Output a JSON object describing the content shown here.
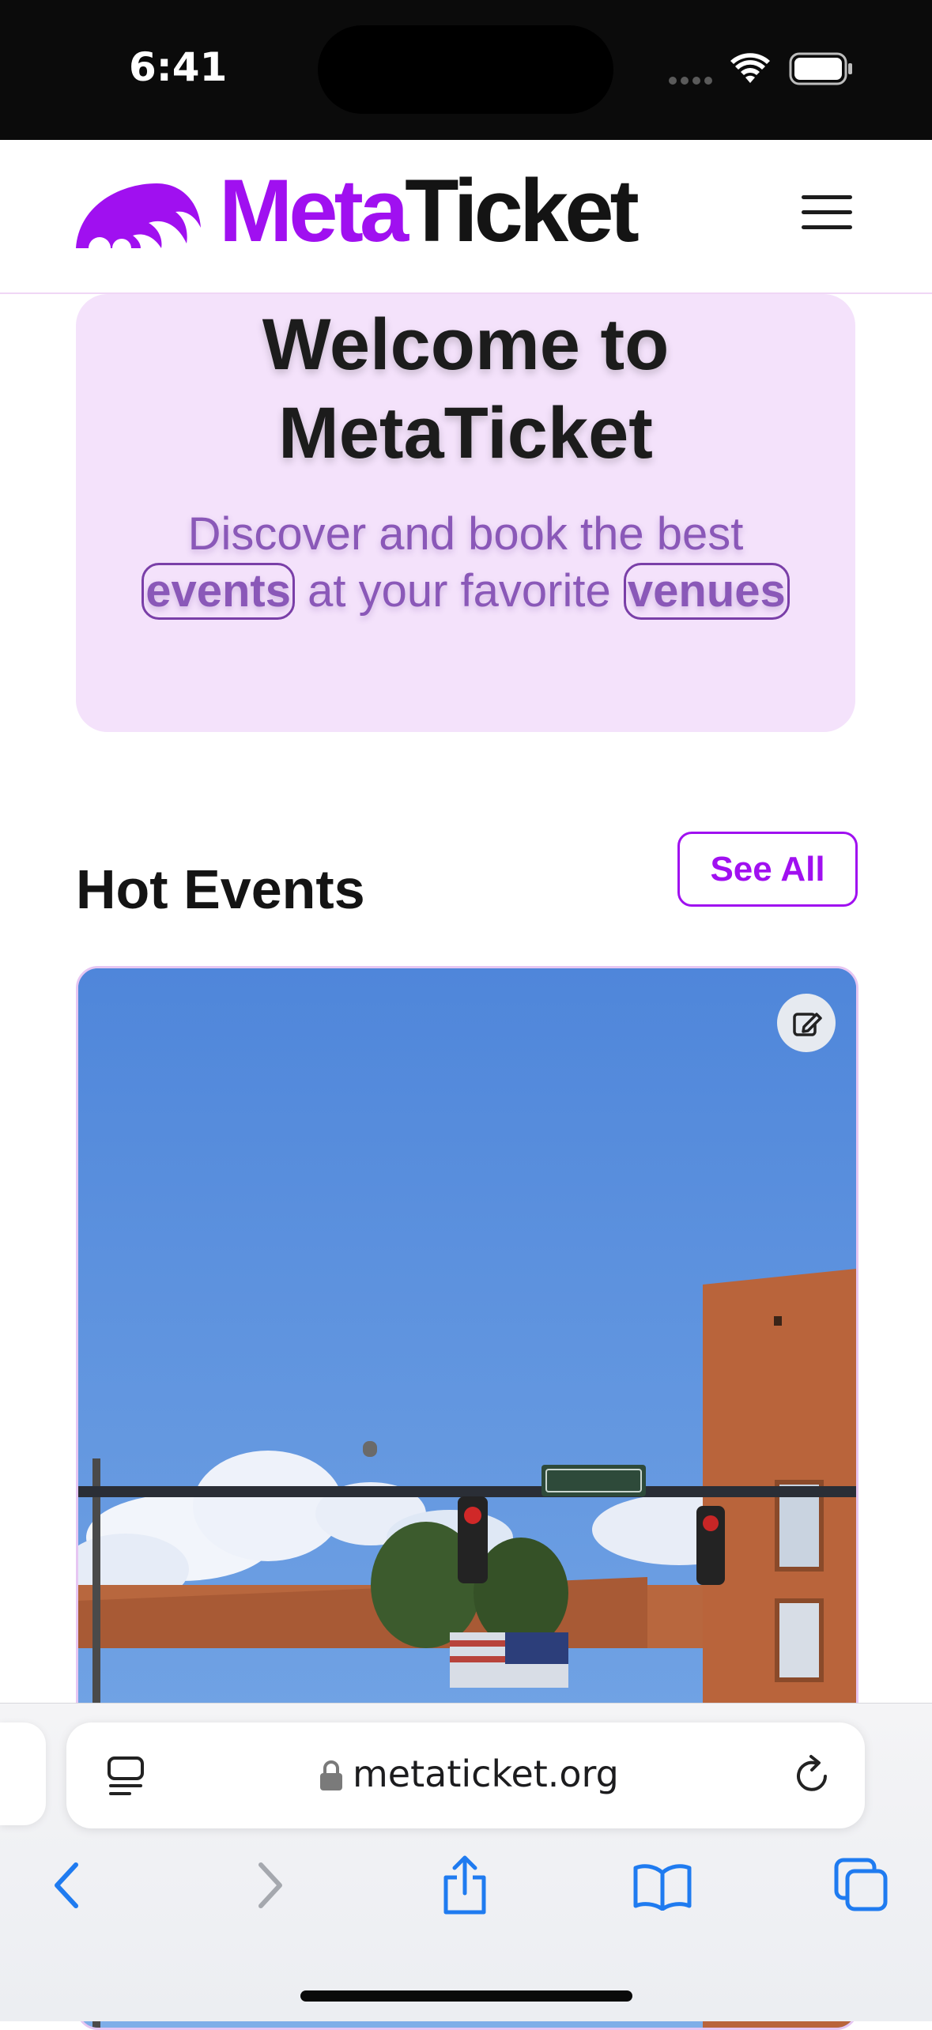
{
  "status_bar": {
    "time": "6:41"
  },
  "header": {
    "logo_part1": "Meta",
    "logo_part2": "Ticket",
    "brand_color": "#a010f0"
  },
  "welcome": {
    "title": "Welcome to MetaTicket",
    "subtitle_before": "Discover and book the best",
    "highlight1": "events",
    "subtitle_middle": "at your favorite",
    "highlight2": "venues"
  },
  "hot_events": {
    "title": "Hot Events",
    "see_all_label": "See All"
  },
  "browser": {
    "url": "metaticket.org",
    "accent_color": "#1f7bf0"
  },
  "icons": [
    "signal-icon",
    "wifi-icon",
    "battery-icon",
    "logo-icon",
    "menu-icon",
    "edit-icon",
    "reader-icon",
    "lock-icon",
    "reload-icon",
    "back-icon",
    "forward-icon",
    "share-icon",
    "bookmarks-icon",
    "tabs-icon"
  ]
}
